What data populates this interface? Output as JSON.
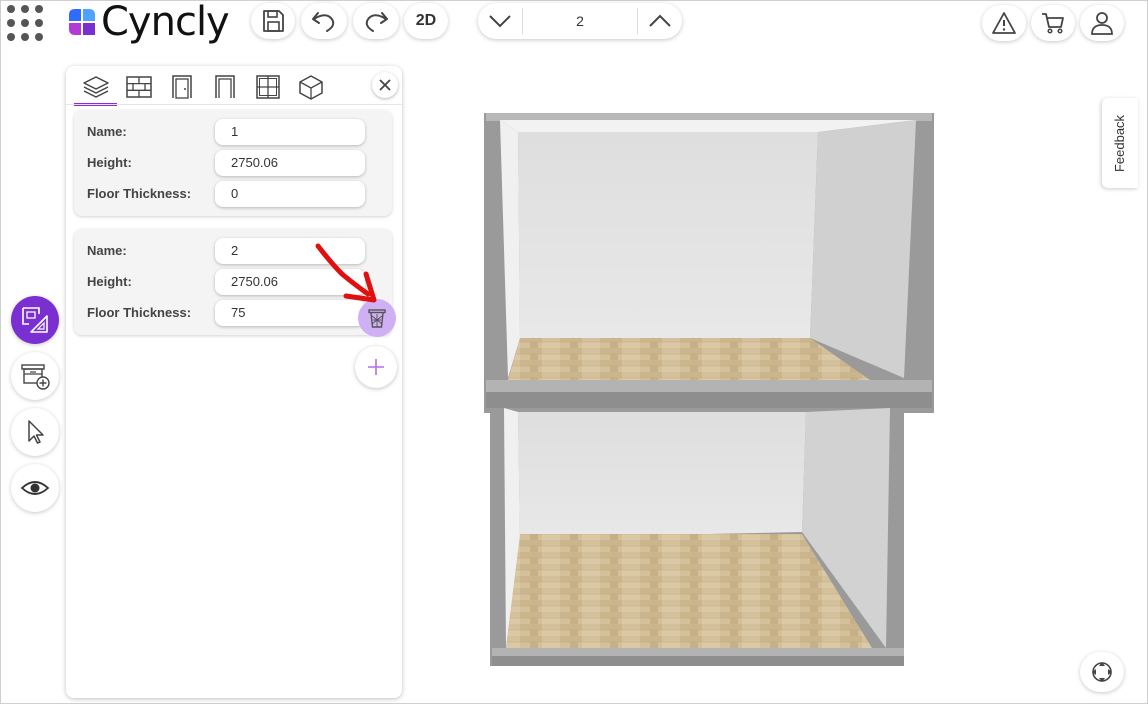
{
  "app": {
    "brand": "Cyncly"
  },
  "toolbar": {
    "view_mode_label": "2D",
    "current_floor": "2"
  },
  "panel": {
    "tabs": [
      "floors-tab",
      "walls-tab",
      "doors-tab",
      "openings-tab",
      "windows-tab",
      "objects-tab"
    ],
    "floors": [
      {
        "name_label": "Name:",
        "name": "1",
        "height_label": "Height:",
        "height": "2750.06",
        "thickness_label": "Floor Thickness:",
        "thickness": "0"
      },
      {
        "name_label": "Name:",
        "name": "2",
        "height_label": "Height:",
        "height": "2750.06",
        "thickness_label": "Floor Thickness:",
        "thickness": "75"
      }
    ]
  },
  "feedback": {
    "label": "Feedback"
  },
  "colors": {
    "accent": "#7a2fd0",
    "accent_light": "#cfb0f5",
    "annotation": "#e01010"
  }
}
